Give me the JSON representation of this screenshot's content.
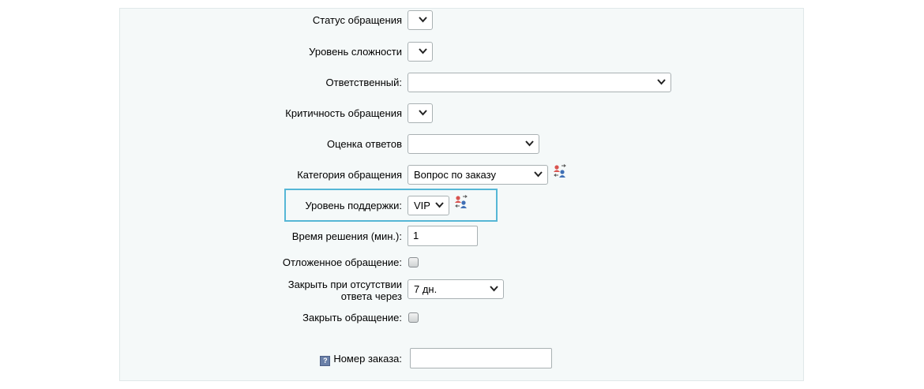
{
  "form": {
    "status_label": "Статус обращения",
    "difficulty_label": "Уровень сложности",
    "responsible_label": "Ответственный:",
    "criticality_label": "Критичность обращения",
    "rating_label": "Оценка ответов",
    "category_label": "Категория обращения",
    "category_value": "Вопрос по заказу",
    "support_level_label": "Уровень поддержки:",
    "support_level_value": "VIP",
    "resolve_time_label": "Время решения (мин.):",
    "resolve_time_value": "1",
    "deferred_label": "Отложенное обращение:",
    "autoclose_label_line1": "Закрыть при отсутствии",
    "autoclose_label_line2": "ответа через",
    "autoclose_value": "7 дн.",
    "close_label": "Закрыть обращение:",
    "order_number_label": "Номер заказа:",
    "order_number_value": "",
    "help_glyph": "?"
  },
  "colors": {
    "highlight_border": "#56b7d6",
    "panel_background": "#f5f9f9",
    "user_icon_red": "#d9534f",
    "user_icon_blue": "#3f6fb5"
  },
  "icons": {
    "chevron": "chevron-down-icon",
    "users_swap": "users-swap-icon",
    "help": "help-icon"
  }
}
